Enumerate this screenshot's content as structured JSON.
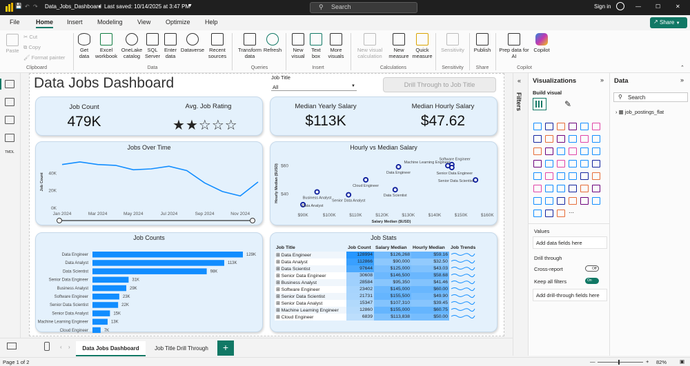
{
  "app": {
    "title": "Data_Jobs_Dashboard",
    "saved": "Last saved: 10/14/2025 at 3:47 PM",
    "search": "Search",
    "signin": "Sign in"
  },
  "menu": {
    "items": [
      "File",
      "Home",
      "Insert",
      "Modeling",
      "View",
      "Optimize",
      "Help"
    ],
    "share": "Share"
  },
  "ribbon": {
    "clipboard": {
      "paste": "Paste",
      "cut": "Cut",
      "copy": "Copy",
      "format": "Format painter",
      "group": "Clipboard"
    },
    "data": {
      "get": "Get data",
      "excel": "Excel workbook",
      "onelake": "OneLake catalog",
      "sql": "SQL Server",
      "enter": "Enter data",
      "dataverse": "Dataverse",
      "recent": "Recent sources",
      "group": "Data"
    },
    "queries": {
      "transform": "Transform data",
      "refresh": "Refresh",
      "group": "Queries"
    },
    "insert": {
      "visual": "New visual",
      "textbox": "Text box",
      "more": "More visuals",
      "group": "Insert"
    },
    "calc": {
      "newvis": "New visual calculation",
      "measure": "New measure",
      "quick": "Quick measure",
      "group": "Calculations"
    },
    "sens": {
      "label": "Sensitivity",
      "group": "Sensitivity"
    },
    "share": {
      "publish": "Publish",
      "group": "Share"
    },
    "copilot": {
      "prep": "Prep data for AI",
      "copilot": "Copilot",
      "group": "Copilot"
    }
  },
  "report": {
    "title": "Data Jobs Dashboard",
    "slicer": {
      "label": "Job Title",
      "value": "All"
    },
    "drill": "Drill Through to Job Title",
    "kpi": {
      "count_label": "Job Count",
      "count_value": "479K",
      "rating_label": "Avg. Job Rating",
      "rating_stars": 2,
      "yearly_label": "Median Yearly Salary",
      "yearly_value": "$113K",
      "hourly_label": "Median Hourly Salary",
      "hourly_value": "$47.62"
    }
  },
  "charts": {
    "over_time": {
      "title": "Jobs Over Time",
      "ylabel": "Job Count",
      "yticks": [
        "40K",
        "20K",
        "0K"
      ],
      "xticks": [
        "Jan 2024",
        "Mar 2024",
        "May 2024",
        "Jul 2024",
        "Sep 2024",
        "Nov 2024"
      ]
    },
    "hourly_vs": {
      "title": "Hourly vs Median Salary",
      "ylabel": "Hourly Median ($USD)",
      "xlabel": "Salary Median ($USD)",
      "yticks": [
        "$60",
        "$40"
      ],
      "xticks": [
        "$90K",
        "$100K",
        "$110K",
        "$120K",
        "$130K",
        "$140K",
        "$150K",
        "$160K"
      ]
    },
    "job_counts": {
      "title": "Job Counts"
    },
    "job_stats": {
      "title": "Job Stats",
      "headers": [
        "Job Title",
        "Job Count",
        "Salary Median",
        "Hourly Median",
        "Job Trends"
      ]
    }
  },
  "chart_data": [
    {
      "type": "line",
      "title": "Jobs Over Time",
      "ylabel": "Job Count",
      "x": [
        "Jan 2024",
        "Feb 2024",
        "Mar 2024",
        "Apr 2024",
        "May 2024",
        "Jun 2024",
        "Jul 2024",
        "Aug 2024",
        "Sep 2024",
        "Oct 2024",
        "Nov 2024",
        "Dec 2024"
      ],
      "values": [
        50000,
        53000,
        50000,
        49000,
        44000,
        45000,
        48000,
        43000,
        29000,
        19000,
        14000,
        30000
      ],
      "ylim": [
        0,
        60000
      ]
    },
    {
      "type": "scatter",
      "title": "Hourly vs Median Salary",
      "xlabel": "Salary Median ($USD)",
      "ylabel": "Hourly Median ($USD)",
      "points": [
        {
          "label": "Data Analyst",
          "x": 90000,
          "y": 32.5
        },
        {
          "label": "Business Analyst",
          "x": 95350,
          "y": 41.46
        },
        {
          "label": "Senior Data Analyst",
          "x": 107310,
          "y": 39.45
        },
        {
          "label": "Cloud Engineer",
          "x": 113838,
          "y": 50
        },
        {
          "label": "Data Scientist",
          "x": 125000,
          "y": 43.03
        },
        {
          "label": "Data Engineer",
          "x": 126268,
          "y": 59.16
        },
        {
          "label": "Software Engineer",
          "x": 145000,
          "y": 60
        },
        {
          "label": "Machine Learning Engineer",
          "x": 146500,
          "y": 60.75
        },
        {
          "label": "Senior Data Engineer",
          "x": 146500,
          "y": 58.68
        },
        {
          "label": "Senior Data Scientist",
          "x": 155500,
          "y": 49.9
        }
      ],
      "xlim": [
        85000,
        162000
      ],
      "ylim": [
        30,
        66
      ]
    },
    {
      "type": "bar",
      "title": "Job Counts",
      "categories": [
        "Data Engineer",
        "Data Analyst",
        "Data Scientist",
        "Senior Data Engineer",
        "Business Analyst",
        "Software Engineer",
        "Senior Data Scientist",
        "Senior Data Analyst",
        "Machine Learning Engineer",
        "Cloud Engineer"
      ],
      "values": [
        129,
        113,
        98,
        31,
        29,
        23,
        22,
        15,
        13,
        7
      ],
      "labels": [
        "129K",
        "113K",
        "98K",
        "31K",
        "29K",
        "23K",
        "22K",
        "15K",
        "13K",
        "7K"
      ]
    },
    {
      "type": "table",
      "title": "Job Stats",
      "rows": [
        [
          "Data Engineer",
          "128994",
          "$126,268",
          "$59.16"
        ],
        [
          "Data Analyst",
          "112866",
          "$90,000",
          "$32.50"
        ],
        [
          "Data Scientist",
          "97644",
          "$125,000",
          "$43.03"
        ],
        [
          "Senior Data Engineer",
          "30608",
          "$146,500",
          "$58.68"
        ],
        [
          "Business Analyst",
          "28584",
          "$95,350",
          "$41.46"
        ],
        [
          "Software Engineer",
          "23402",
          "$145,000",
          "$60.00"
        ],
        [
          "Senior Data Scientist",
          "21731",
          "$155,500",
          "$49.90"
        ],
        [
          "Senior Data Analyst",
          "15347",
          "$107,310",
          "$39.45"
        ],
        [
          "Machine Learning Engineer",
          "12860",
          "$155,000",
          "$60.75"
        ],
        [
          "Cloud Engineer",
          "6839",
          "$113,838",
          "$50.00"
        ]
      ]
    }
  ],
  "panes": {
    "filters": "Filters",
    "viz": {
      "title": "Visualizations",
      "build": "Build visual",
      "values": "Values",
      "add": "Add data fields here",
      "drill": "Drill through",
      "cross": "Cross-report",
      "cross_state": "Off",
      "keep": "Keep all filters",
      "keep_state": "On",
      "add_drill": "Add drill-through fields here"
    },
    "data": {
      "title": "Data",
      "search": "Search",
      "table": "job_postings_flat"
    }
  },
  "tabs": [
    "Data Jobs Dashboard",
    "Job Title Drill Through"
  ],
  "status": {
    "page": "Page 1 of 2",
    "zoom": "82%"
  },
  "colors": {
    "accent": "#117865",
    "bar": "#118dff",
    "card": "#e4f1fc"
  }
}
